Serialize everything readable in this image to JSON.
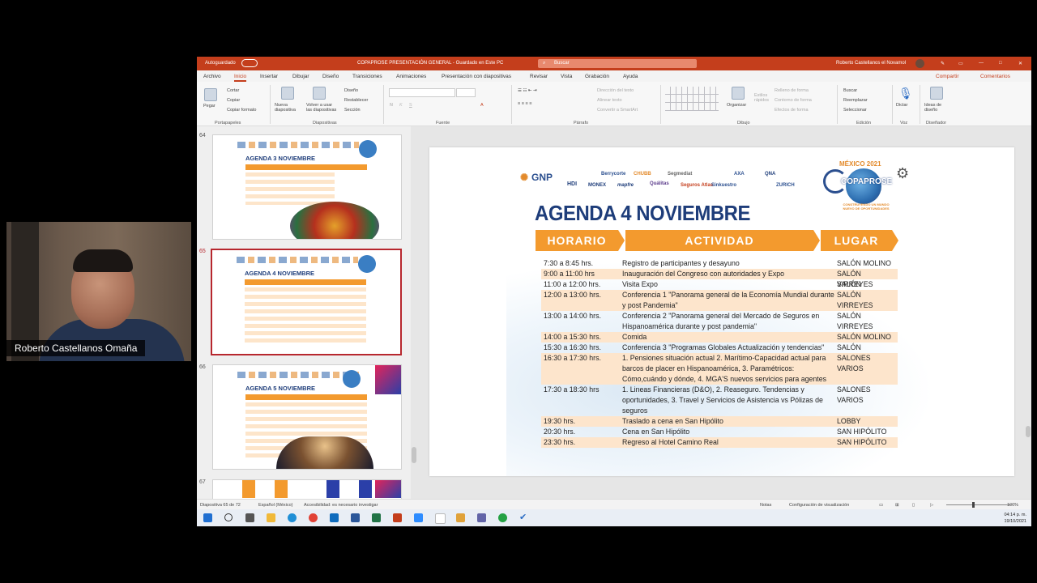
{
  "webcam": {
    "participant_name": "Roberto Castellanos Omaña"
  },
  "window": {
    "autosave_label": "Autoguardado",
    "doc_title": "COPAPROSE PRESENTACIÓN GENERAL - Guardado en Este PC",
    "search_placeholder": "Buscar",
    "user_name": "Roberto Castellanos el Novamol"
  },
  "menu": {
    "tabs": [
      "Archivo",
      "Inicio",
      "Insertar",
      "Dibujar",
      "Diseño",
      "Transiciones",
      "Animaciones",
      "Presentación con diapositivas",
      "Revisar",
      "Vista",
      "Grabación",
      "Ayuda"
    ],
    "active_tab": "Inicio",
    "share_label": "Compartir",
    "comments_label": "Comentarios"
  },
  "ribbon": {
    "groups": [
      "Portapapeles",
      "Diapositivas",
      "Fuente",
      "Párrafo",
      "Dibujo",
      "Edición",
      "Voz",
      "Diseñador"
    ],
    "paste": "Pegar",
    "cut": "Cortar",
    "copy": "Copiar",
    "format_painter": "Copiar formato",
    "new_slide": "Nueva diapositiva",
    "reuse_slides": "Volver a usar las diapositivas",
    "layout": "Diseño",
    "reset": "Restablecer",
    "section": "Sección",
    "arrange": "Organizar",
    "quick_styles": "Estilos rápidos",
    "shape_fill": "Relleno de forma",
    "shape_outline": "Contorno de forma",
    "shape_effects": "Efectos de forma",
    "find": "Buscar",
    "replace": "Reemplazar",
    "select": "Seleccionar",
    "dictate": "Dictar",
    "design_ideas": "Ideas de diseño",
    "text_direction": "Dirección del texto",
    "align_text": "Alinear texto",
    "smartart": "Convertir a SmartArt"
  },
  "thumbnails": [
    {
      "number": "64",
      "title": "AGENDA 3 NOVIEMBRE",
      "selected": false
    },
    {
      "number": "65",
      "title": "AGENDA 4 NOVIEMBRE",
      "selected": true
    },
    {
      "number": "66",
      "title": "AGENDA 5 NOVIEMBRE",
      "selected": false
    },
    {
      "number": "67",
      "title": "",
      "selected": false
    }
  ],
  "thumb_headers": [
    "HORARIO",
    "ACTIVIDAD",
    "LUGAR"
  ],
  "slide": {
    "sponsors_row1": [
      "GNP",
      "Berrycorte",
      "CHUBB",
      "Segmediat",
      "AXA",
      "QNA"
    ],
    "sponsors_row2": [
      "HDI",
      "MONEX",
      "mapfre",
      "Quálitas",
      "Seguros Atlas",
      "Sinkuestro",
      "ZURICH"
    ],
    "event_badge": "MÉXICO 2021",
    "event_brand": "COPAPROSE",
    "event_tagline": "CONSTRUYENDO UN MUNDO NUEVO DE OPORTUNIDADES",
    "title": "AGENDA 4 NOVIEMBRE",
    "headers": {
      "horario": "HORARIO",
      "actividad": "ACTIVIDAD",
      "lugar": "LUGAR"
    },
    "rows": [
      {
        "time": "7:30 a 8:45 hrs.",
        "activity": "Registro de participantes y desayuno",
        "place": "SALÓN MOLINO",
        "lines": 1,
        "shade": false
      },
      {
        "time": "9:00 a 11:00 hrs",
        "activity": "Inauguración del Congreso con autoridades y Expo",
        "place": "SALÓN VIRREYES",
        "lines": 1,
        "shade": true
      },
      {
        "time": "11:00 a 12:00 hrs.",
        "activity": "Visita Expo",
        "place": "SALÓN VIRREYES",
        "lines": 1,
        "shade": false
      },
      {
        "time": "12:00 a 13:00 hrs.",
        "activity": "Conferencia 1 \"Panorama general de la Economía Mundial durante y post Pandemia\"",
        "place": "SALÓN VIRREYES",
        "lines": 2,
        "shade": true
      },
      {
        "time": "13:00 a 14:00 hrs.",
        "activity": "Conferencia 2 \"Panorama general del Mercado de Seguros en Hispanoamérica durante y post pandemia\"",
        "place": "SALÓN VIRREYES",
        "lines": 2,
        "shade": false
      },
      {
        "time": "14:00 a 15:30 hrs.",
        "activity": "Comida",
        "place": "SALÓN MOLINO",
        "lines": 1,
        "shade": true
      },
      {
        "time": "15:30 a 16:30 hrs.",
        "activity": "Conferencia 3 \"Programas Globales Actualización y tendencias\"",
        "place": "SALÓN VIRREYES",
        "lines": 1,
        "shade": false
      },
      {
        "time": "16:30 a 17:30 hrs.",
        "activity": "1. Pensiones situación actual 2. Marítimo-Capacidad actual para barcos de placer en Hispanoamérica, 3. Paramétricos: Cómo,cuándo y dónde, 4. MGA'S nuevos servicios para agentes",
        "place": "SALONES VARIOS",
        "lines": 3,
        "shade": true
      },
      {
        "time": "17:30 a 18:30 hrs",
        "activity": "1. Lineas Financieras (D&O), 2. Reaseguro. Tendencias y oportunidades, 3. Travel y Servicios de Asistencia vs Pólizas de seguros",
        "place": "SALONES VARIOS",
        "lines": 3,
        "shade": false
      },
      {
        "time": "19:30 hrs.",
        "activity": "Traslado a cena en San Hipólito",
        "place": "LOBBY",
        "lines": 1,
        "shade": true
      },
      {
        "time": "20:30 hrs.",
        "activity": "Cena en San Hipólito",
        "place": "SAN HIPÓLITO",
        "lines": 1,
        "shade": false
      },
      {
        "time": "23:30 hrs.",
        "activity": "Regreso al Hotel Camino Real",
        "place": "SAN HIPÓLITO",
        "lines": 1,
        "shade": true
      }
    ]
  },
  "status": {
    "slide_counter": "Diapositiva 65 de 72",
    "language": "Español (México)",
    "accessibility": "Accesibilidad: es necesario investigar",
    "notes": "Notas",
    "display_settings": "Configuración de visualización",
    "zoom": "106%"
  },
  "clock": {
    "time": "04:14 p. m.",
    "date": "19/10/2021"
  },
  "colors": {
    "accent": "#c43e1c",
    "orange": "#f39a2e",
    "navy": "#1e3d7a",
    "shade": "#fde5cc"
  }
}
